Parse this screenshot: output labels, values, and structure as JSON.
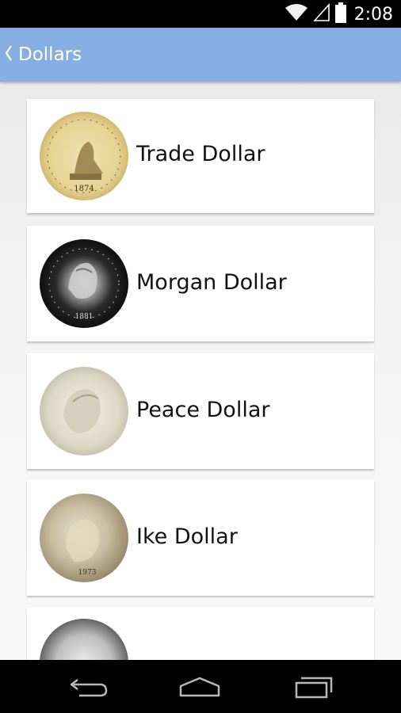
{
  "status_bar": {
    "time": "2:08",
    "icons": [
      "wifi-icon",
      "cell-signal-icon",
      "battery-icon"
    ]
  },
  "action_bar": {
    "up_icon": "chevron-left-icon",
    "title": "Dollars",
    "color": "#86aee2"
  },
  "dollars": [
    {
      "label": "Trade Dollar",
      "coin_icon": "trade-dollar-coin-image",
      "year": "1874"
    },
    {
      "label": "Morgan Dollar",
      "coin_icon": "morgan-dollar-coin-image",
      "year": "1881"
    },
    {
      "label": "Peace Dollar",
      "coin_icon": "peace-dollar-coin-image"
    },
    {
      "label": "Ike Dollar",
      "coin_icon": "ike-dollar-coin-image",
      "year": "1973"
    },
    {
      "label": "",
      "coin_icon": "liberty-coin-image"
    }
  ],
  "nav_bar": {
    "buttons": [
      "back-icon",
      "home-icon",
      "recents-icon"
    ]
  }
}
